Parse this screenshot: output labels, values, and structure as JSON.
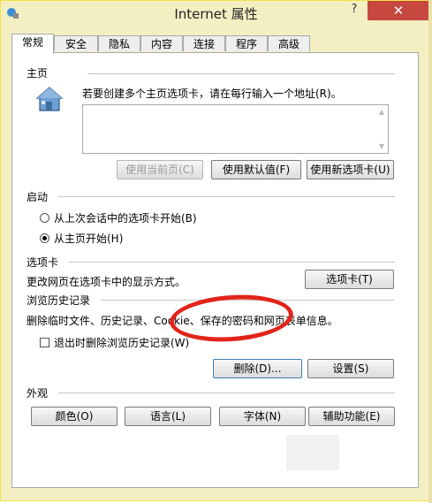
{
  "window": {
    "title": "Internet 属性",
    "help": "?",
    "close": "✕"
  },
  "tabs": [
    "常规",
    "安全",
    "隐私",
    "内容",
    "连接",
    "程序",
    "高级"
  ],
  "homepage": {
    "label": "主页",
    "description": "若要创建多个主页选项卡，请在每行输入一个地址(R)。",
    "buttons": {
      "use_current": "使用当前页(C)",
      "use_default": "使用默认值(F)",
      "use_new_tab": "使用新选项卡(U)"
    }
  },
  "startup": {
    "label": "启动",
    "option1": "从上次会话中的选项卡开始(B)",
    "option2": "从主页开始(H)"
  },
  "tabs_section": {
    "label": "选项卡",
    "description": "更改网页在选项卡中的显示方式。",
    "button": "选项卡(T)"
  },
  "history": {
    "label": "浏览历史记录",
    "description": "删除临时文件、历史记录、Cookie、保存的密码和网页表单信息。",
    "checkbox": "退出时删除浏览历史记录(W)",
    "delete_button": "删除(D)...",
    "settings_button": "设置(S)"
  },
  "appearance": {
    "label": "外观",
    "colors": "颜色(O)",
    "languages": "语言(L)",
    "fonts": "字体(N)",
    "accessibility": "辅助功能(E)"
  }
}
